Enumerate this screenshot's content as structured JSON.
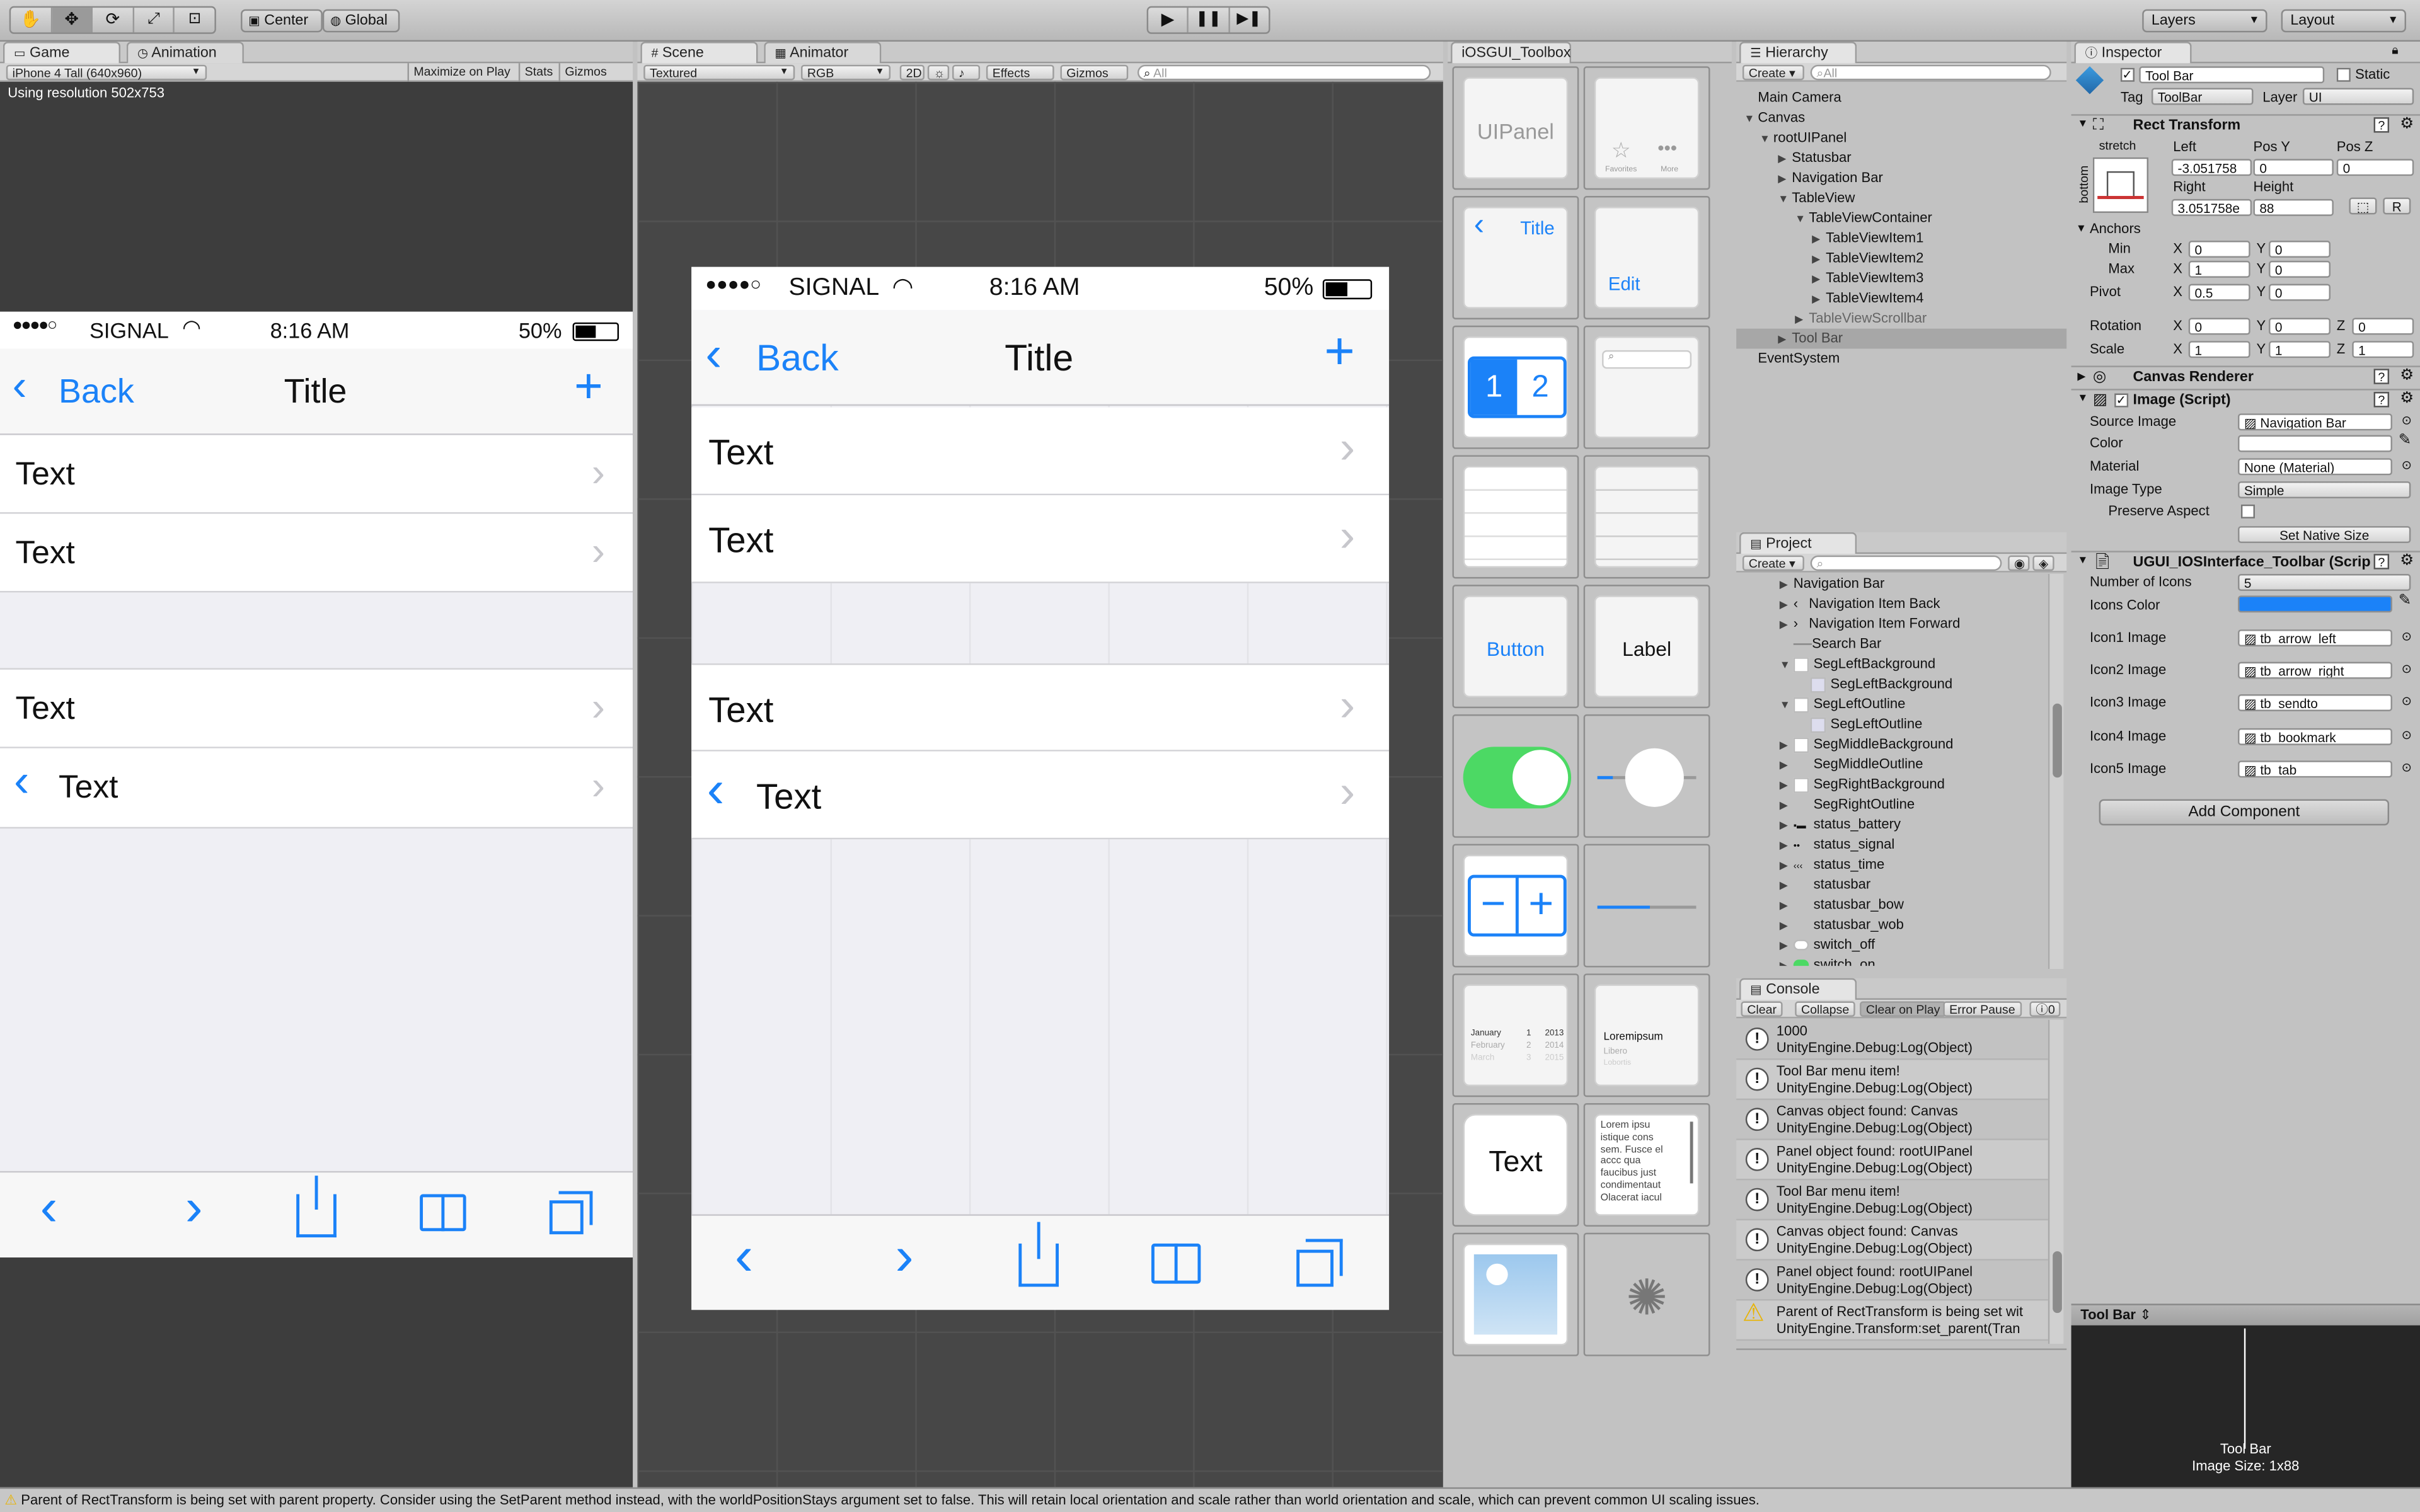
{
  "toolbar": {
    "pivot": "Center",
    "space": "Global",
    "layers": "Layers",
    "layout": "Layout"
  },
  "game": {
    "tab_game": "Game",
    "tab_animation": "Animation",
    "resolution_select": "iPhone 4 Tall (640x960)",
    "maximize": "Maximize on Play",
    "stats": "Stats",
    "gizmos": "Gizmos",
    "resolution_text": "Using resolution 502x753"
  },
  "scene": {
    "tab_scene": "Scene",
    "tab_animator": "Animator",
    "shading": "Textured",
    "render": "RGB",
    "mode2d": "2D",
    "effects": "Effects",
    "gizmos": "Gizmos",
    "search_placeholder": "All"
  },
  "ios": {
    "signal": "SIGNAL",
    "time": "8:16 AM",
    "battery": "50%",
    "back": "Back",
    "title": "Title",
    "rows": [
      "Text",
      "Text",
      "Text",
      "Text"
    ]
  },
  "toolbox": {
    "tab": "iOSGUI_Toolbox",
    "panel": "UIPanel",
    "tabbar_favorites": "Favorites",
    "tabbar_more": "More",
    "nav_title": "Title",
    "edit": "Edit",
    "seg1": "1",
    "seg2": "2",
    "button": "Button",
    "label": "Label",
    "picker_month": "January",
    "picker_day": "1",
    "picker_year": "2013",
    "picker_month2": "February",
    "picker_day2": "2",
    "picker_year2": "2014",
    "picker_month3": "March",
    "picker_day3": "3",
    "picker_year3": "2015",
    "list_title": "Loremipsum",
    "list_sub1": "Libero",
    "list_sub2": "Lobortis",
    "text_field": "Text",
    "lorem": "Lorem ipsu istique cons sem. Fusce el accc qua faucibus just condimentaut Olacerat iacul"
  },
  "hierarchy": {
    "tab": "Hierarchy",
    "create": "Create",
    "search_placeholder": "All",
    "items": [
      "Main Camera",
      "Canvas",
      "rootUIPanel",
      "Statusbar",
      "Navigation Bar",
      "TableView",
      "TableViewContainer",
      "TableViewItem1",
      "TableViewItem2",
      "TableViewItem3",
      "TableViewItem4",
      "TableViewScrollbar",
      "Tool Bar",
      "EventSystem"
    ]
  },
  "project": {
    "tab": "Project",
    "create": "Create",
    "items": [
      "Navigation Bar",
      "Navigation Item Back",
      "Navigation Item Forward",
      "Search Bar",
      "SegLeftBackground",
      "SegLeftBackground",
      "SegLeftOutline",
      "SegLeftOutline",
      "SegMiddleBackground",
      "SegMiddleOutline",
      "SegRightBackground",
      "SegRightOutline",
      "status_battery",
      "status_signal",
      "status_time",
      "statusbar",
      "statusbar_bow",
      "statusbar_wob",
      "switch_off",
      "switch_on"
    ]
  },
  "console": {
    "tab": "Console",
    "clear": "Clear",
    "collapse": "Collapse",
    "clear_on_play": "Clear on Play",
    "error_pause": "Error Pause",
    "count": "0",
    "entries": [
      {
        "l1": "1000",
        "l2": "UnityEngine.Debug:Log(Object)"
      },
      {
        "l1": "Tool Bar menu item!",
        "l2": "UnityEngine.Debug:Log(Object)"
      },
      {
        "l1": "Canvas object found: Canvas",
        "l2": "UnityEngine.Debug:Log(Object)"
      },
      {
        "l1": "Panel object found: rootUIPanel",
        "l2": "UnityEngine.Debug:Log(Object)"
      },
      {
        "l1": "Tool Bar menu item!",
        "l2": "UnityEngine.Debug:Log(Object)"
      },
      {
        "l1": "Canvas object found: Canvas",
        "l2": "UnityEngine.Debug:Log(Object)"
      },
      {
        "l1": "Panel object found: rootUIPanel",
        "l2": "UnityEngine.Debug:Log(Object)"
      },
      {
        "l1": "Parent of RectTransform is being set wit",
        "l2": "UnityEngine.Transform:set_parent(Tran"
      }
    ]
  },
  "inspector": {
    "tab": "Inspector",
    "object_name": "Tool Bar",
    "static": "Static",
    "tag_label": "Tag",
    "tag": "ToolBar",
    "layer_label": "Layer",
    "layer": "UI",
    "rect_transform": "Rect Transform",
    "stretch": "stretch",
    "bottom": "bottom",
    "left_lbl": "Left",
    "posy_lbl": "Pos Y",
    "posz_lbl": "Pos Z",
    "left": "-3.051758",
    "posy": "0",
    "posz": "0",
    "right_lbl": "Right",
    "height_lbl": "Height",
    "right": "3.051758e",
    "height": "88",
    "r_btn": "R",
    "anchors": "Anchors",
    "min": "Min",
    "max": "Max",
    "pivot": "Pivot",
    "rotation": "Rotation",
    "scale": "Scale",
    "x": "X",
    "y": "Y",
    "z": "Z",
    "min_x": "0",
    "min_y": "0",
    "max_x": "1",
    "max_y": "0",
    "pivot_x": "0.5",
    "pivot_y": "0",
    "rot_x": "0",
    "rot_y": "0",
    "rot_z": "0",
    "scale_x": "1",
    "scale_y": "1",
    "scale_z": "1",
    "canvas_renderer": "Canvas Renderer",
    "image_script": "Image (Script)",
    "source_image_lbl": "Source Image",
    "source_image": "Navigation Bar",
    "color_lbl": "Color",
    "material_lbl": "Material",
    "material": "None (Material)",
    "image_type_lbl": "Image Type",
    "image_type": "Simple",
    "preserve_lbl": "Preserve Aspect",
    "set_native": "Set Native Size",
    "toolbar_script": "UGUI_IOSInterface_Toolbar (Script)",
    "num_icons_lbl": "Number of Icons",
    "num_icons": "5",
    "icons_color_lbl": "Icons Color",
    "icon_labels": [
      "Icon1 Image",
      "Icon2 Image",
      "Icon3 Image",
      "Icon4 Image",
      "Icon5 Image"
    ],
    "icon_values": [
      "tb_arrow_left",
      "tb_arrow_right",
      "tb_sendto",
      "tb_bookmark",
      "tb_tab"
    ],
    "add_component": "Add Component",
    "preview_title": "Tool Bar",
    "preview_name": "Tool Bar",
    "preview_size": "Image Size: 1x88"
  },
  "status": {
    "message": "Parent of RectTransform is being set with parent property. Consider using the SetParent method instead, with the worldPositionStays argument set to false. This will retain local orientation and scale rather than world orientation and scale, which can prevent common UI scaling issues."
  },
  "colors": {
    "ios_blue": "#1b82f8",
    "switch_green": "#4cd964",
    "unity_bg": "#c2c2c2",
    "selection": "#a7a7a7"
  }
}
